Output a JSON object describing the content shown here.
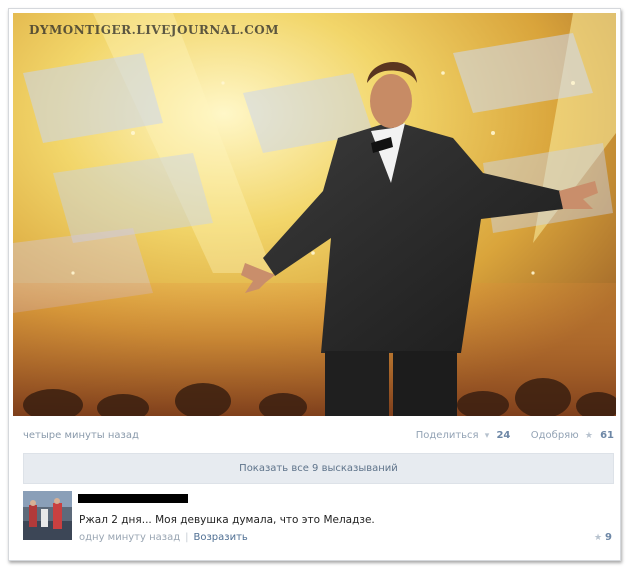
{
  "post": {
    "watermark": "DYMONTIGER.LIVEJOURNAL.COM",
    "time": "четыре минуты назад",
    "share_label": "Поделиться",
    "share_count": "24",
    "like_label": "Одобряю",
    "like_count": "61",
    "share_icon": "megaphone-icon",
    "like_icon": "star-icon"
  },
  "show_all_label": "Показать все 9 высказываний",
  "comment": {
    "text": "Ржал 2 дня... Моя девушка думала, что это Меладзе.",
    "time": "одну минуту назад",
    "reply_label": "Возразить",
    "like_count": "9",
    "like_icon": "star-icon"
  },
  "colors": {
    "link": "#4f6f93",
    "count": "#6d87a6",
    "meta": "#8a9aab",
    "show_all_bg": "#e7ebf0"
  }
}
